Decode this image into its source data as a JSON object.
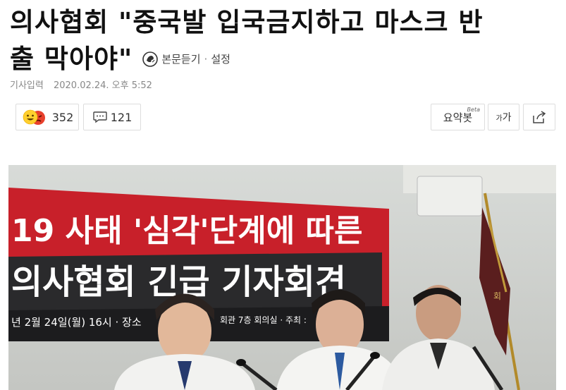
{
  "article": {
    "title_line1": "의사협회 \"중국발 입국금지하고 마스크 반",
    "title_line2": "출 막아야\"",
    "listen_label": "본문듣기",
    "settings_label": "설정",
    "meta_label": "기사입력",
    "meta_datetime": "2020.02.24. 오후 5:52"
  },
  "actions": {
    "reaction_count": "352",
    "comment_count": "121",
    "summary_label": "요약봇",
    "summary_badge": "Beta",
    "font_label": "가"
  },
  "photo": {
    "banner_line1": "19 사태 '심각'단계에 따른",
    "banner_line2": "의사협회 긴급 기자회견",
    "banner_line3": "년 2월 24일(월) 16시 · 장소",
    "banner_line3b": "회관 7층 회의실 · 주최 :",
    "flag_text": "회"
  },
  "colors": {
    "banner_red": "#c8202a",
    "banner_dark": "#2a2a2c"
  }
}
